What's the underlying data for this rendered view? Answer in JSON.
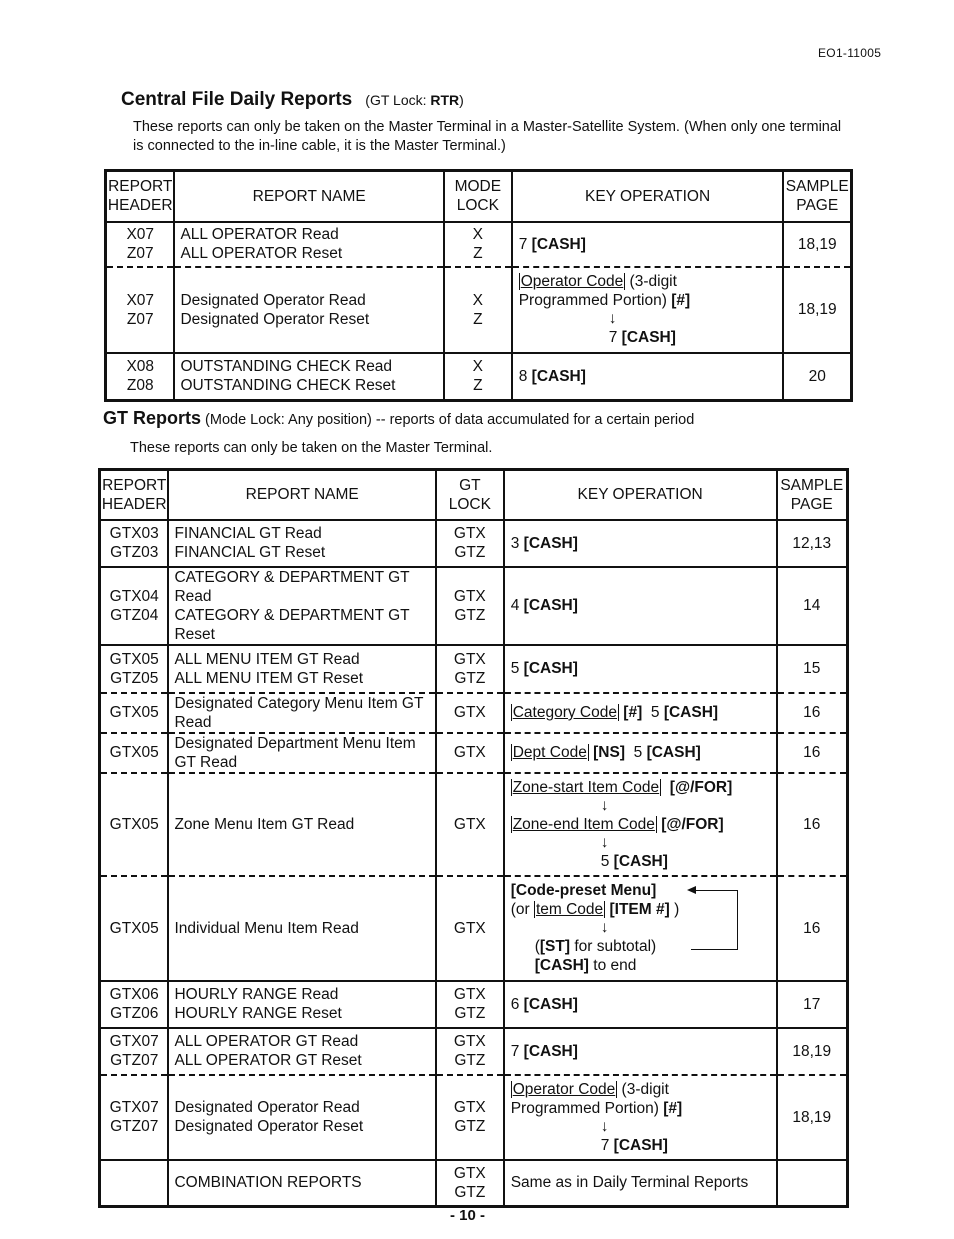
{
  "doc_id": "EO1-11005",
  "section1": {
    "title": "Central File Daily Reports",
    "subtitle_prefix": "(GT Lock: ",
    "subtitle_bold": "RTR",
    "subtitle_suffix": ")",
    "intro": "These reports can only be taken on the Master Terminal in a Master-Satellite System.  (When only one terminal is connected to the in-line cable, it is the Master Terminal.)",
    "headers": {
      "report_header_1": "REPORT",
      "report_header_2": "HEADER",
      "report_name": "REPORT NAME",
      "lock_1": "MODE",
      "lock_2": "LOCK",
      "key_operation": "KEY OPERATION",
      "sample_1": "SAMPLE",
      "sample_2": "PAGE"
    },
    "rows": [
      {
        "hdr1": "X07",
        "hdr2": "Z07",
        "name1": "ALL OPERATOR Read",
        "name2": "ALL OPERATOR Reset",
        "lock1": "X",
        "lock2": "Z",
        "key_num": "7",
        "key_bold": "[CASH]",
        "page": "18,19"
      },
      {
        "hdr1": "X07",
        "hdr2": "Z07",
        "name1": "Designated Operator Read",
        "name2": "Designated Operator Reset",
        "lock1": "X",
        "lock2": "Z",
        "key_code": "Operator Code",
        "key_line1_rest": " (3-digit",
        "key_line2": "Programmed Portion) ",
        "key_line2_bold": "[#]",
        "arrow": "↓",
        "key_line3_num": "7 ",
        "key_line3_bold": "[CASH]",
        "page": "18,19"
      },
      {
        "hdr1": "X08",
        "hdr2": "Z08",
        "name1": "OUTSTANDING CHECK Read",
        "name2": "OUTSTANDING CHECK Reset",
        "lock1": "X",
        "lock2": "Z",
        "key_num": "8",
        "key_bold": "[CASH]",
        "page": "20"
      }
    ]
  },
  "section2": {
    "title": "GT Reports",
    "subtitle": " (Mode Lock: Any position)  -- reports of data accumulated for a certain period",
    "intro": "These reports can only be taken on the Master Terminal.",
    "headers": {
      "report_header_1": "REPORT",
      "report_header_2": "HEADER",
      "report_name": "REPORT NAME",
      "lock_1": "GT",
      "lock_2": "LOCK",
      "key_operation": "KEY OPERATION",
      "sample_1": "SAMPLE",
      "sample_2": "PAGE"
    },
    "rows": [
      {
        "hdr1": "GTX03",
        "hdr2": "GTZ03",
        "name1": "FINANCIAL GT Read",
        "name2": "FINANCIAL GT Reset",
        "lock1": "GTX",
        "lock2": "GTZ",
        "key_num": "3",
        "key_bold": "[CASH]",
        "page": "12,13"
      },
      {
        "hdr1": "GTX04",
        "hdr2": "GTZ04",
        "name1": "CATEGORY & DEPARTMENT GT Read",
        "name2": "CATEGORY & DEPARTMENT GT Reset",
        "lock1": "GTX",
        "lock2": "GTZ",
        "key_num": "4",
        "key_bold": "[CASH]",
        "page": "14"
      },
      {
        "hdr1": "GTX05",
        "hdr2": "GTZ05",
        "name1": "ALL MENU ITEM GT Read",
        "name2": "ALL MENU ITEM GT Reset",
        "lock1": "GTX",
        "lock2": "GTZ",
        "key_num": "5",
        "key_bold": "[CASH]",
        "page": "15"
      },
      {
        "hdr1": "GTX05",
        "name1": "Designated Category Menu Item GT Read",
        "lock1": "GTX",
        "key_code": "Category Code",
        "key_b1": "[#]",
        "key_num": "5",
        "key_bold": "[CASH]",
        "page": "16"
      },
      {
        "hdr1": "GTX05",
        "name1": "Designated Department Menu Item GT Read",
        "lock1": "GTX",
        "key_code": "Dept Code",
        "key_b1": "[NS]",
        "key_num": "5",
        "key_bold": "[CASH]",
        "page": "16"
      },
      {
        "hdr1": "GTX05",
        "name1": "Zone Menu Item GT Read",
        "lock1": "GTX",
        "key_code1": "Zone-start Item Code",
        "key_b1": "[@/FOR]",
        "arrow": "↓",
        "key_code2": "Zone-end Item Code",
        "key_b2": "[@/FOR]",
        "key_num": "5",
        "key_bold": "[CASH]",
        "page": "16"
      },
      {
        "hdr1": "GTX05",
        "name1": "Individual Menu Item Read",
        "lock1": "GTX",
        "key_line1": "[Code-preset Menu]",
        "key_line2_pre": "(or ",
        "key_code": "tem Code",
        "key_line2_bold": "[ITEM #]",
        "key_line2_post": " )",
        "arrow": "↓",
        "key_line3_bold": "[ST]",
        "key_line3_pre": "(",
        "key_line3_post": " for subtotal)",
        "key_line4_bold": "[CASH]",
        "key_line4_post": " to end",
        "page": "16"
      },
      {
        "hdr1": "GTX06",
        "hdr2": "GTZ06",
        "name1": "HOURLY RANGE Read",
        "name2": "HOURLY RANGE Reset",
        "lock1": "GTX",
        "lock2": "GTZ",
        "key_num": "6",
        "key_bold": "[CASH]",
        "page": "17"
      },
      {
        "hdr1": "GTX07",
        "hdr2": "GTZ07",
        "name1": "ALL OPERATOR GT Read",
        "name2": "ALL OPERATOR GT Reset",
        "lock1": "GTX",
        "lock2": "GTZ",
        "key_num": "7",
        "key_bold": "[CASH]",
        "page": "18,19"
      },
      {
        "hdr1": "GTX07",
        "hdr2": "GTZ07",
        "name1": "Designated Operator Read",
        "name2": "Designated Operator Reset",
        "lock1": "GTX",
        "lock2": "GTZ",
        "key_code": "Operator Code",
        "key_line1_rest": " (3-digit",
        "key_line2": "Programmed Portion) ",
        "key_line2_bold": "[#]",
        "arrow": "↓",
        "key_line3_num": "7 ",
        "key_line3_bold": "[CASH]",
        "page": "18,19"
      },
      {
        "hdr1": "",
        "name1": "COMBINATION REPORTS",
        "lock1": "GTX",
        "lock2": "GTZ",
        "key_text": "Same as in Daily Terminal Reports",
        "page": ""
      }
    ]
  },
  "page_number": "- 10 -"
}
